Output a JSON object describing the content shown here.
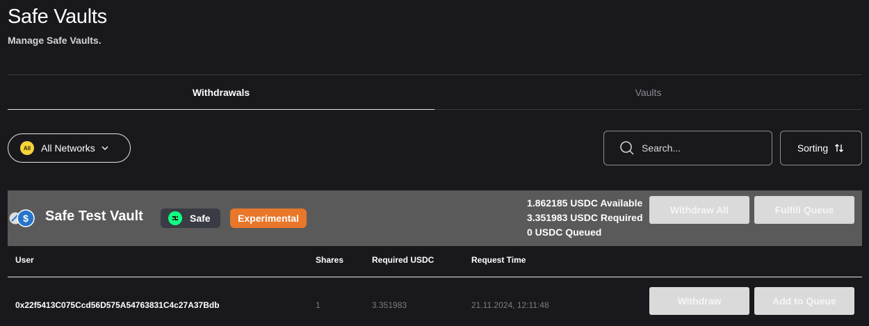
{
  "page": {
    "title": "Safe Vaults",
    "subtitle": "Manage Safe Vaults."
  },
  "tabs": [
    {
      "label": "Withdrawals",
      "active": true
    },
    {
      "label": "Vaults",
      "active": false
    }
  ],
  "filters": {
    "network_badge": "All",
    "network_label": "All Networks",
    "search_placeholder": "Search...",
    "sorting_label": "Sorting"
  },
  "vault": {
    "name": "Safe Test Vault",
    "chip_safe": "Safe",
    "chip_experimental": "Experimental",
    "available": "1.862185 USDC Available",
    "required": "3.351983 USDC Required",
    "queued": "0 USDC Queued",
    "withdraw_all_label": "Withdraw All",
    "fulfill_queue_label": "Fulfill Queue"
  },
  "table": {
    "headers": [
      "User",
      "Shares",
      "Required USDC",
      "Request Time"
    ],
    "rows": [
      {
        "user": "0x22f5413C075Ccd56D575A54763831C4c27A37Bdb",
        "shares": "1",
        "required_usdc": "3.351983",
        "request_time": "21.11.2024, 12:11:48",
        "withdraw_label": "Withdraw",
        "queue_label": "Add to Queue"
      }
    ]
  },
  "colors": {
    "background": "#19181c",
    "vault_header": "#5a5a5a",
    "experimental": "#e8772a",
    "all_badge": "#f6d43a",
    "safe_icon": "#12ff80",
    "usdc_blue": "#2775ca"
  }
}
